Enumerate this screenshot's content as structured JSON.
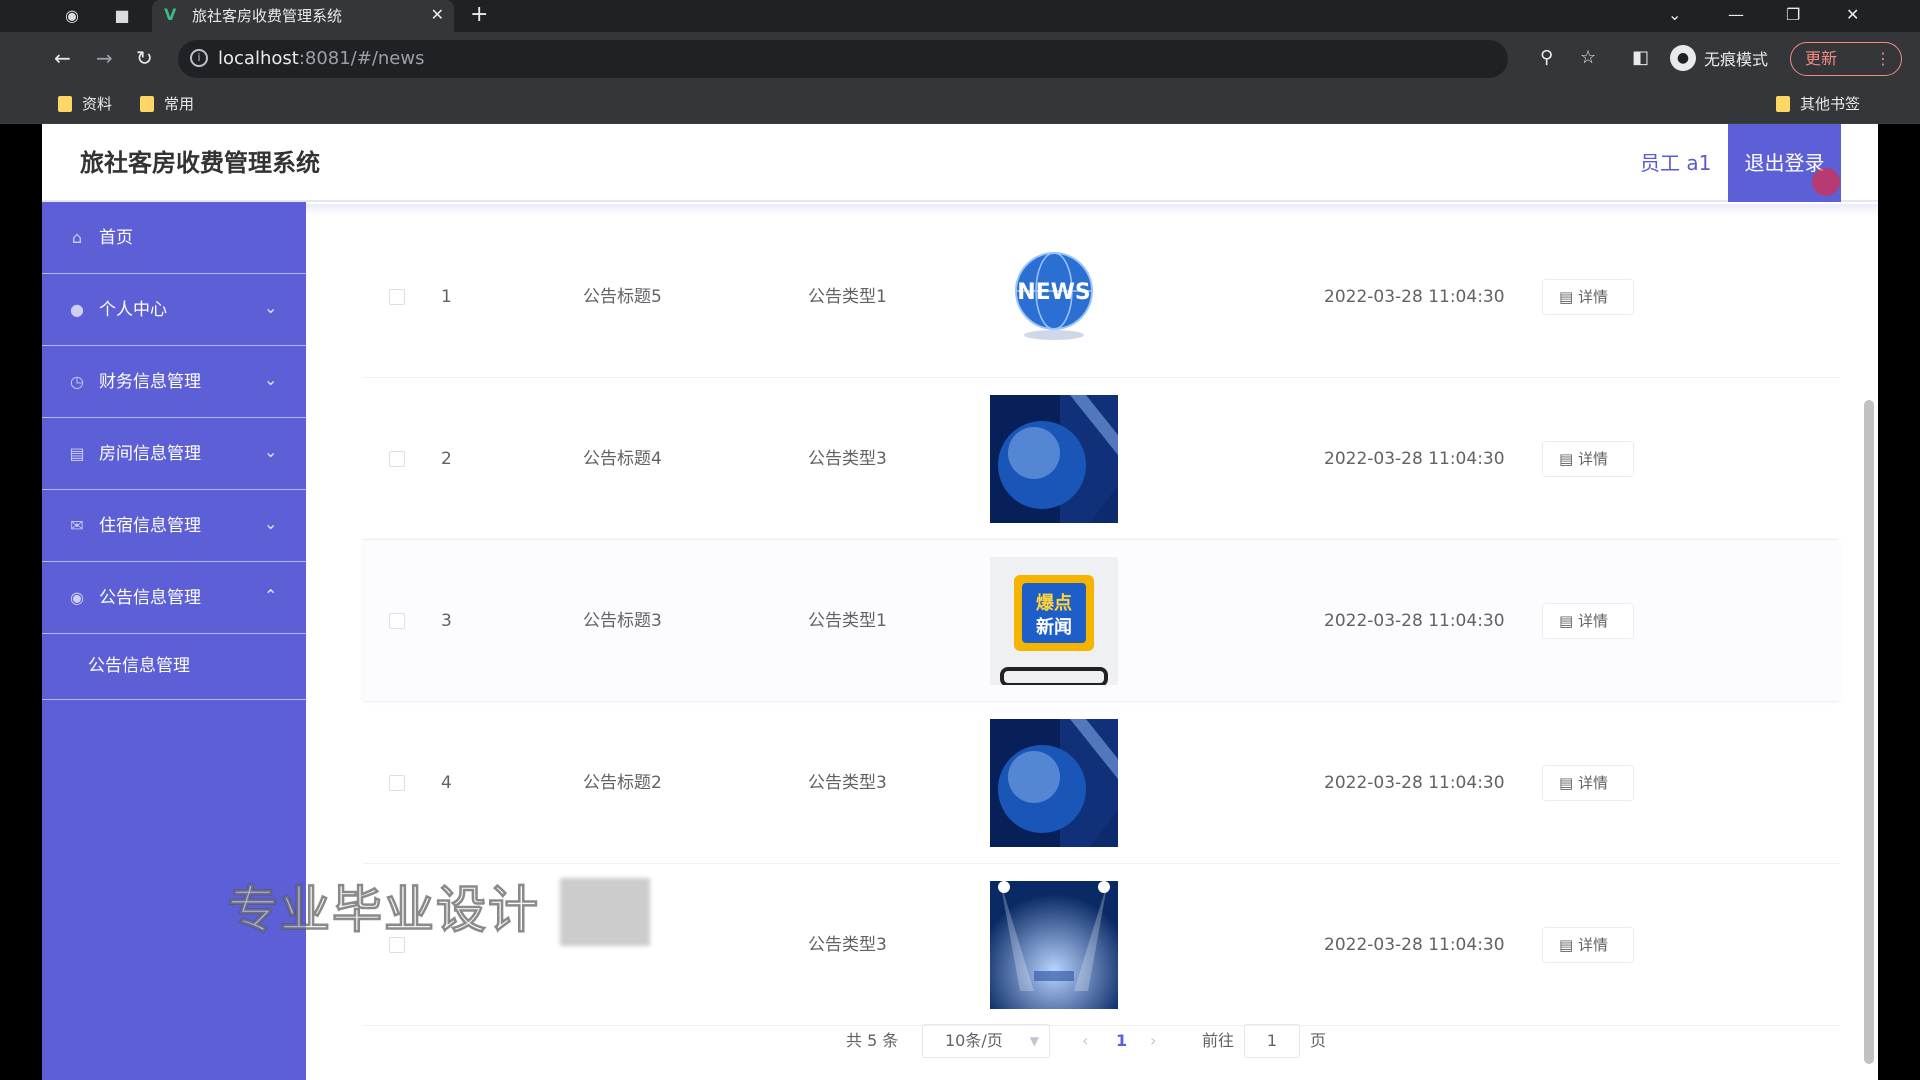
{
  "browser": {
    "tab_title": "旅社客房收费管理系统",
    "url_host": "localhost",
    "url_rest": ":8081/#/news",
    "incognito_label": "无痕模式",
    "update_label": "更新",
    "bookmarks": [
      "资料",
      "常用"
    ],
    "other_bookmarks": "其他书签"
  },
  "header": {
    "title": "旅社客房收费管理系统",
    "user": "员工 a1",
    "logout": "退出登录"
  },
  "sidebar": {
    "items": [
      {
        "label": "首页",
        "icon": "home-icon"
      },
      {
        "label": "个人中心",
        "icon": "user-icon"
      },
      {
        "label": "财务信息管理",
        "icon": "clock-icon"
      },
      {
        "label": "房间信息管理",
        "icon": "document-icon"
      },
      {
        "label": "住宿信息管理",
        "icon": "mail-icon"
      },
      {
        "label": "公告信息管理",
        "icon": "shield-icon"
      }
    ],
    "sub_item": "公告信息管理"
  },
  "table": {
    "rows": [
      {
        "index": "1",
        "title": "公告标题5",
        "type": "公告类型1",
        "time": "2022-03-28 11:04:30",
        "action": "详情",
        "image": "globe-news"
      },
      {
        "index": "2",
        "title": "公告标题4",
        "type": "公告类型3",
        "time": "2022-03-28 11:04:30",
        "action": "详情",
        "image": "globe-blue"
      },
      {
        "index": "3",
        "title": "公告标题3",
        "type": "公告类型1",
        "time": "2022-03-28 11:04:30",
        "action": "详情",
        "image": "breaking-news"
      },
      {
        "index": "4",
        "title": "公告标题2",
        "type": "公告类型3",
        "time": "2022-03-28 11:04:30",
        "action": "详情",
        "image": "globe-blue"
      },
      {
        "index": "5",
        "title": "",
        "type": "公告类型3",
        "time": "2022-03-28 11:04:30",
        "action": "详情",
        "image": "stage-lights"
      }
    ]
  },
  "pagination": {
    "total": "共 5 条",
    "page_size": "10条/页",
    "current_page": "1",
    "goto_label": "前往",
    "goto_value": "1",
    "page_unit": "页"
  },
  "overlay": {
    "watermark": "专业毕业设计"
  },
  "thumbs": {
    "breaking_line1": "爆点",
    "breaking_line2": "新闻",
    "news_text": "NEWS"
  },
  "colors": {
    "accent": "#5c5fd6",
    "browser_dark": "#202124"
  }
}
